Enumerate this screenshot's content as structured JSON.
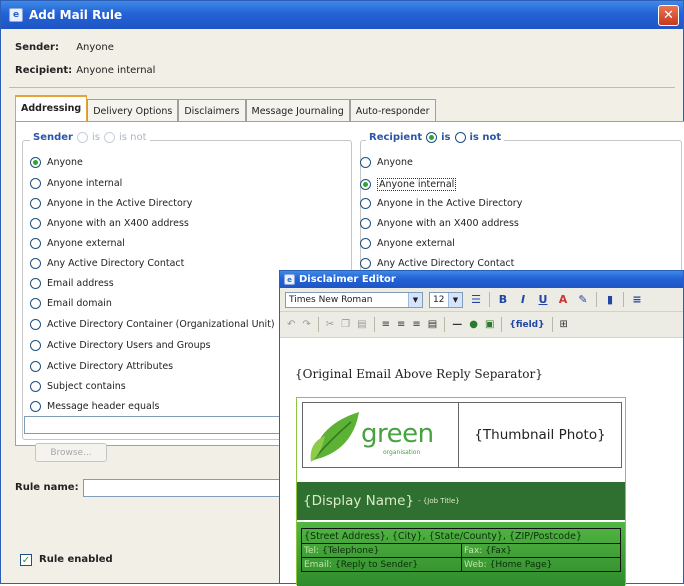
{
  "window": {
    "title": "Add Mail Rule",
    "close_glyph": "✕"
  },
  "header": {
    "sender_label": "Sender:",
    "sender_value": "Anyone",
    "recipient_label": "Recipient:",
    "recipient_value": "Anyone internal"
  },
  "tabs": [
    "Addressing",
    "Delivery Options",
    "Disclaimers",
    "Message Journaling",
    "Auto-responder"
  ],
  "sender_group": {
    "title": "Sender",
    "is_label": "is",
    "is_not_label": "is not",
    "options": [
      {
        "label": "Anyone",
        "selected": true
      },
      {
        "label": "Anyone internal",
        "selected": false
      },
      {
        "label": "Anyone in the Active Directory",
        "selected": false
      },
      {
        "label": "Anyone with an X400 address",
        "selected": false
      },
      {
        "label": "Anyone external",
        "selected": false
      },
      {
        "label": "Any Active Directory Contact",
        "selected": false
      },
      {
        "label": "Email address",
        "selected": false
      },
      {
        "label": "Email domain",
        "selected": false
      },
      {
        "label": "Active Directory Container (Organizational Unit)",
        "selected": false
      },
      {
        "label": "Active Directory Users and Groups",
        "selected": false
      },
      {
        "label": "Active Directory Attributes",
        "selected": false
      },
      {
        "label": "Subject contains",
        "selected": false
      },
      {
        "label": "Message header equals",
        "selected": false
      }
    ],
    "browse_label": "Browse..."
  },
  "recipient_group": {
    "title": "Recipient",
    "is_label": "is",
    "is_not_label": "is not",
    "options": [
      {
        "label": "Anyone",
        "selected": false
      },
      {
        "label": "Anyone internal",
        "selected": true
      },
      {
        "label": "Anyone in the Active Directory",
        "selected": false
      },
      {
        "label": "Anyone with an X400 address",
        "selected": false
      },
      {
        "label": "Anyone external",
        "selected": false
      },
      {
        "label": "Any Active Directory Contact",
        "selected": false
      }
    ]
  },
  "rule_name_label": "Rule name:",
  "rule_enabled_label": "Rule enabled",
  "editor": {
    "title": "Disclaimer Editor",
    "font": "Times New Roman",
    "size": "12",
    "field_label": "{field}",
    "separator_text": "{Original Email Above Reply Separator}",
    "logo_word": "green",
    "logo_sub": "organisation",
    "thumbnail": "{Thumbnail Photo}",
    "display_name": "{Display Name}",
    "job_title": "- {Job Title}",
    "address": "{Street Address}, {City}, {State/County}, {ZIP/Postcode}",
    "tel_label": "Tel:",
    "tel_value": "{Telephone}",
    "fax_label": "Fax:",
    "fax_value": "{Fax}",
    "email_label": "Email:",
    "email_value": "{Reply to Sender}",
    "web_label": "Web:",
    "web_value": "{Home Page}"
  },
  "colors": {
    "titlebar": "#2462d6",
    "group_title": "#2a56a8",
    "signature_green": "#47a23f",
    "name_bar": "#2f6f2f"
  }
}
